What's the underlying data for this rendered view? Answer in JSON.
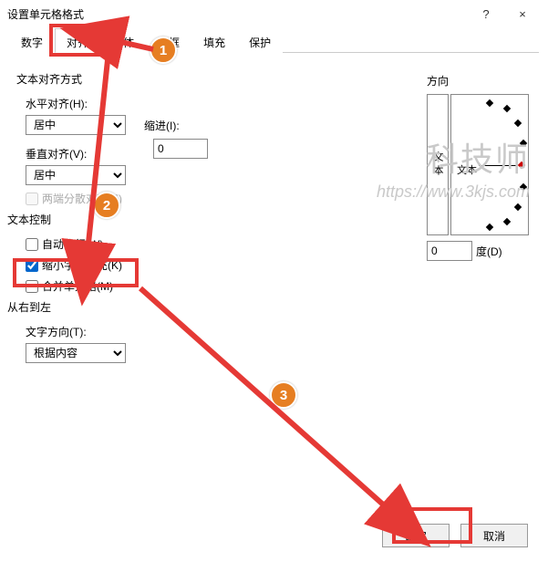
{
  "window": {
    "title": "设置单元格格式",
    "help": "?",
    "close": "×"
  },
  "tabs": {
    "t0": "数字",
    "t1": "对齐",
    "t2": "字体",
    "t3": "边框",
    "t4": "填充",
    "t5": "保护"
  },
  "active_tab": "对齐",
  "align": {
    "section": "文本对齐方式",
    "h_label": "水平对齐(H):",
    "h_value": "居中",
    "indent_label": "缩进(I):",
    "indent_value": "0",
    "v_label": "垂直对齐(V):",
    "v_value": "居中",
    "justify_label": "两端分散对齐(E)"
  },
  "control": {
    "section": "文本控制",
    "wrap": "自动换行(W)",
    "shrink": "缩小字体填充(K)",
    "merge": "合并单元格(M)"
  },
  "rtl": {
    "section": "从右到左",
    "dir_label": "文字方向(T):",
    "dir_value": "根据内容"
  },
  "direction": {
    "section": "方向",
    "text": "文本",
    "degree_value": "0",
    "degree_label": "度(D)"
  },
  "buttons": {
    "ok": "确定",
    "cancel": "取消"
  },
  "badges": {
    "n1": "1",
    "n2": "2",
    "n3": "3"
  },
  "watermark": {
    "l1": "科技师",
    "l2": "https://www.3kjs.com"
  }
}
